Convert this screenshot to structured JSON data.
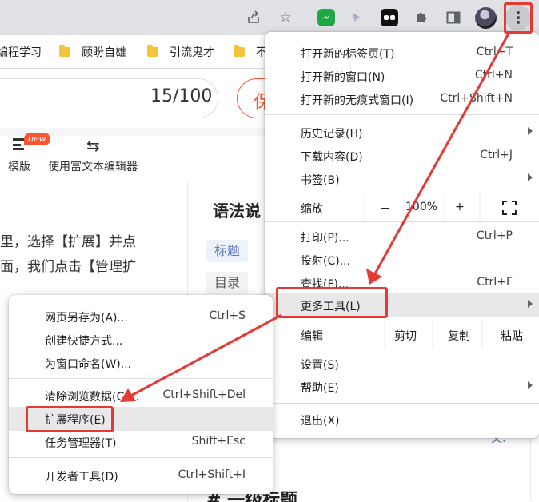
{
  "colors": {
    "accent": "#fc5531",
    "annotation_red": "#e53935",
    "link_blue": "#5c7bc2"
  },
  "toolbar": {
    "icons": [
      "share-icon",
      "star-icon",
      "messenger-extension-icon",
      "cursor-extension-icon",
      "mask-extension-icon",
      "puzzle-extensions-icon",
      "side-panel-icon",
      "avatar",
      "kebab-menu-icon"
    ],
    "menu_glyph": "⋮"
  },
  "bookmarks": [
    "编程学习",
    "顾盼自雄",
    "引流鬼才",
    "不"
  ],
  "editor": {
    "char_count": "15/100",
    "save_label": "保",
    "tools": [
      {
        "label": "模版",
        "badge": "new"
      },
      {
        "label": "使用富文本编辑器"
      }
    ],
    "body_lines": [
      "里，选择【扩展】并点",
      "面，我们点击【管理扩"
    ],
    "side_title": "语法说",
    "tags": [
      "标题",
      "目录"
    ],
    "side_link": "文.",
    "heading_preview": "#  一级标题"
  },
  "chrome_menu": {
    "group1": [
      {
        "label": "打开新的标签页(T)",
        "shortcut": "Ctrl+T"
      },
      {
        "label": "打开新的窗口(N)",
        "shortcut": "Ctrl+N"
      },
      {
        "label": "打开新的无痕式窗口(I)",
        "shortcut": "Ctrl+Shift+N"
      }
    ],
    "group2": [
      {
        "label": "历史记录(H)",
        "shortcut": "",
        "submenu": true
      },
      {
        "label": "下载内容(D)",
        "shortcut": "Ctrl+J"
      },
      {
        "label": "书签(B)",
        "shortcut": "",
        "submenu": true
      }
    ],
    "zoom": {
      "label": "缩放",
      "minus": "－",
      "value": "100%",
      "plus": "+"
    },
    "group3": [
      {
        "label": "打印(P)...",
        "shortcut": "Ctrl+P"
      },
      {
        "label": "投射(C)...",
        "shortcut": ""
      },
      {
        "label": "查找(F)...",
        "shortcut": "Ctrl+F"
      },
      {
        "label": "更多工具(L)",
        "shortcut": "",
        "submenu": true,
        "highlighted": true
      }
    ],
    "edit": {
      "label": "编辑",
      "cut": "剪切",
      "copy": "复制",
      "paste": "粘贴"
    },
    "group4": [
      {
        "label": "设置(S)",
        "shortcut": ""
      },
      {
        "label": "帮助(E)",
        "shortcut": "",
        "submenu": true
      }
    ],
    "group5": [
      {
        "label": "退出(X)",
        "shortcut": ""
      }
    ]
  },
  "more_tools_menu": {
    "group1": [
      {
        "label": "网页另存为(A)...",
        "shortcut": "Ctrl+S"
      },
      {
        "label": "创建快捷方式...",
        "shortcut": ""
      },
      {
        "label": "为窗口命名(W)...",
        "shortcut": ""
      }
    ],
    "group2": [
      {
        "label": "清除浏览数据(C)...",
        "shortcut": "Ctrl+Shift+Del"
      },
      {
        "label": "扩展程序(E)",
        "shortcut": "",
        "highlighted": true
      },
      {
        "label": "任务管理器(T)",
        "shortcut": "Shift+Esc"
      }
    ],
    "group3": [
      {
        "label": "开发者工具(D)",
        "shortcut": "Ctrl+Shift+I"
      }
    ]
  }
}
